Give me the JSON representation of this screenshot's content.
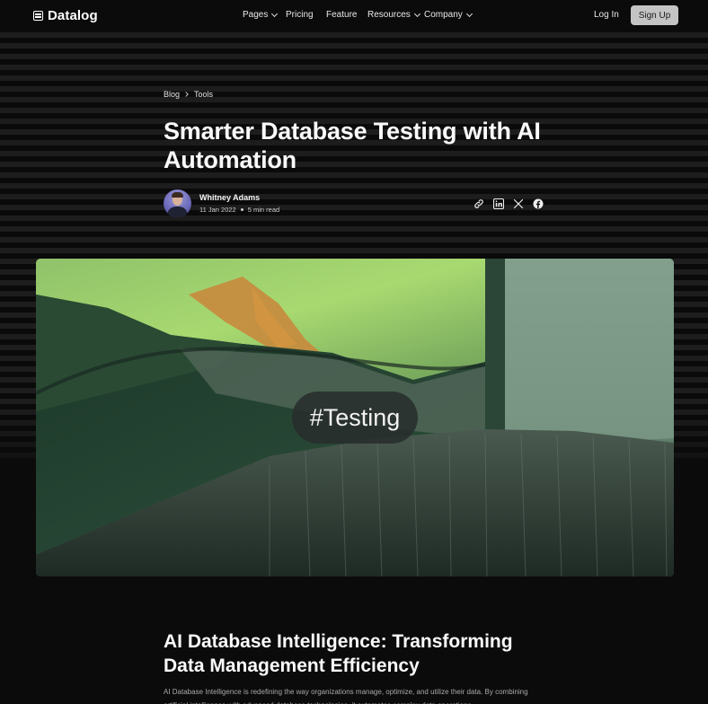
{
  "nav": {
    "logo_text": "Datalog",
    "items": [
      {
        "label": "Pages",
        "has_dropdown": true
      },
      {
        "label": "Pricing",
        "has_dropdown": false
      },
      {
        "label": "Feature",
        "has_dropdown": false
      },
      {
        "label": "Resources",
        "has_dropdown": true
      },
      {
        "label": "Company",
        "has_dropdown": true
      }
    ],
    "login_label": "Log In",
    "signup_label": "Sign Up"
  },
  "breadcrumb": [
    "Blog",
    "Tools"
  ],
  "post": {
    "title": "Smarter Database Testing with AI Automation",
    "author_name": "Whitney Adams",
    "date": "11 Jan 2022",
    "read_time": "5 min read",
    "share_icons": [
      "link-icon",
      "linkedin-icon",
      "x-icon",
      "facebook-icon"
    ],
    "hero_tag": "#Testing"
  },
  "article": {
    "heading": "AI Database Intelligence: Transforming Data Management Efficiency",
    "intro": "AI Database Intelligence is redefining the way organizations manage, optimize, and utilize their data. By combining artificial intelligence with advanced database technologies, it automates complex data operations"
  },
  "colors": {
    "background": "#0b0b0b",
    "signup_button": "#c4c4c4",
    "text": "#f2f2f2"
  }
}
